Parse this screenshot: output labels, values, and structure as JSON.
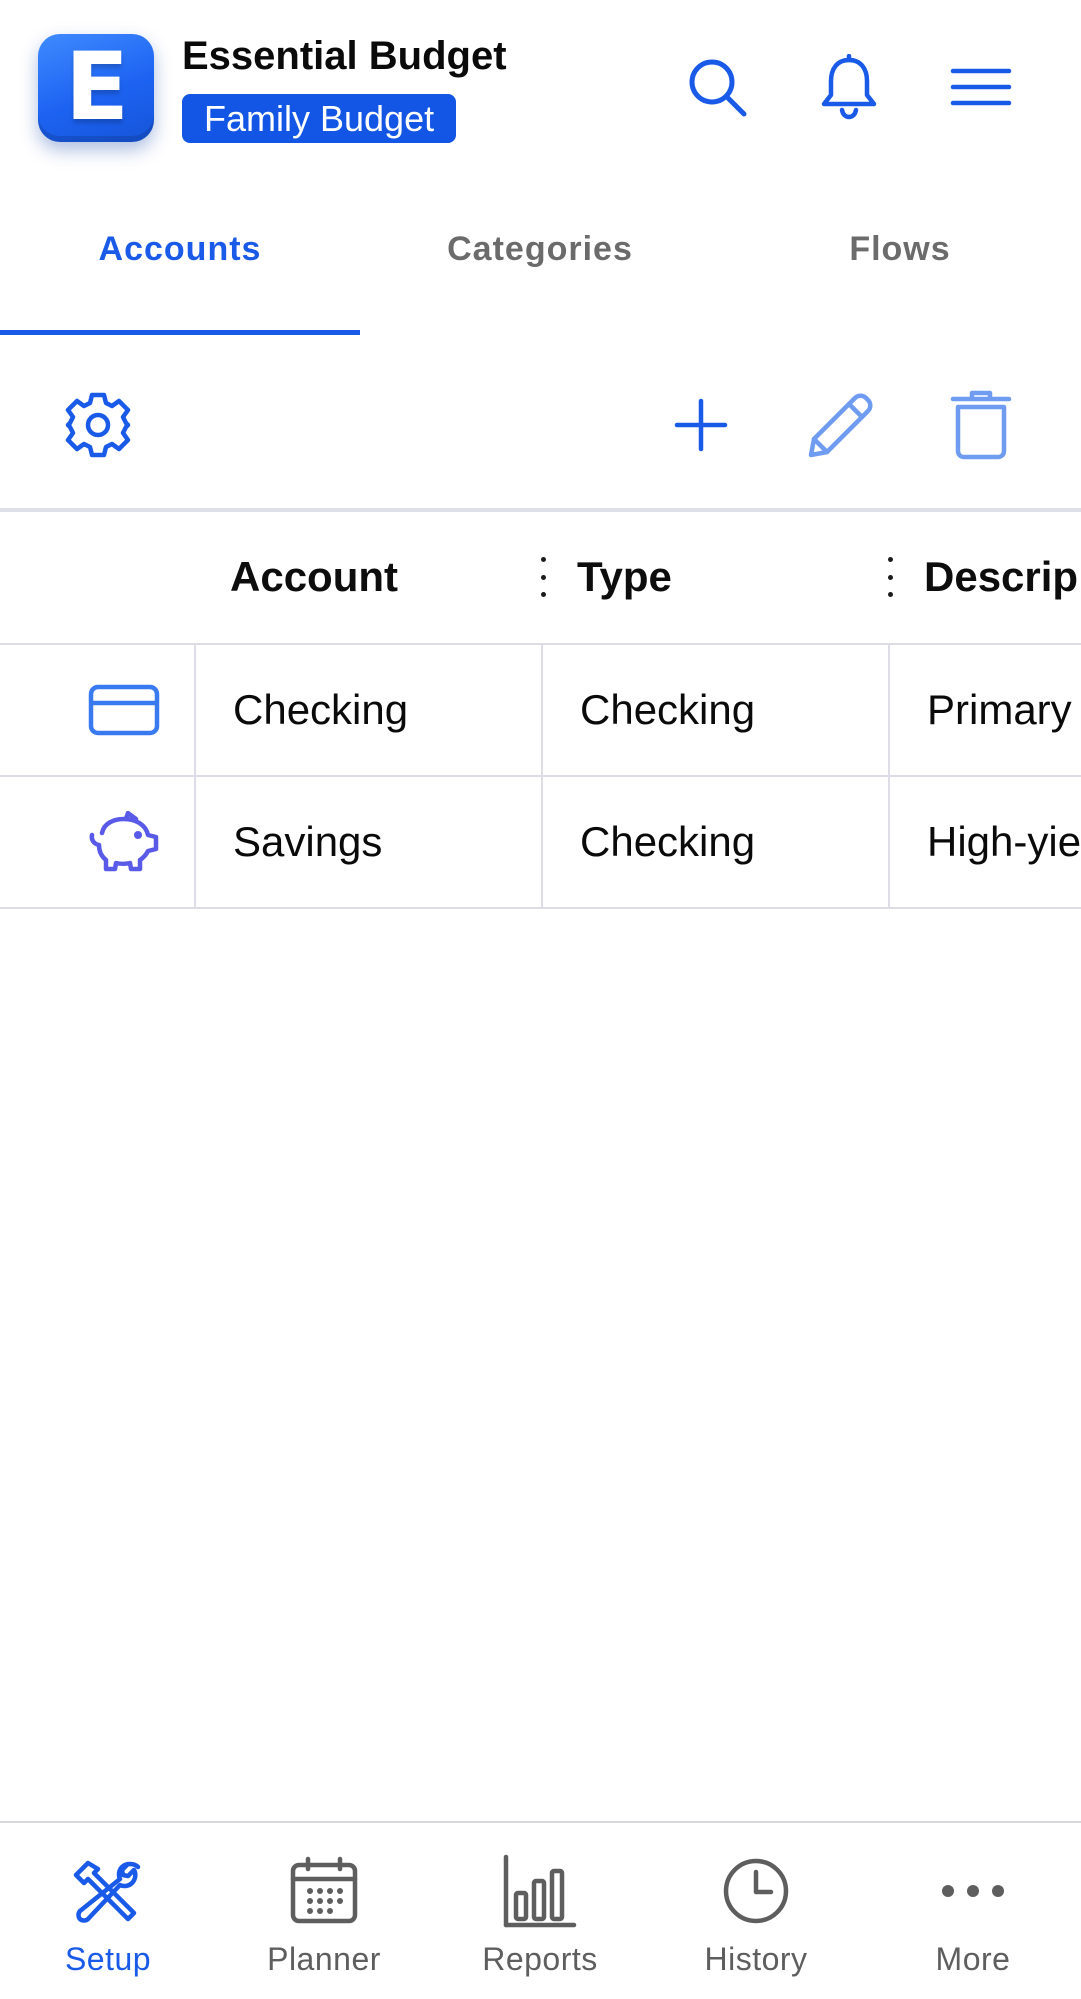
{
  "header": {
    "logo_letter": "E",
    "app_title": "Essential Budget",
    "budget_name": "Family Budget",
    "icons": [
      "search-icon",
      "bell-icon",
      "menu-icon"
    ]
  },
  "tabs": [
    {
      "label": "Accounts",
      "active": true
    },
    {
      "label": "Categories",
      "active": false
    },
    {
      "label": "Flows",
      "active": false
    }
  ],
  "toolbar": {
    "icons": [
      "gear-icon",
      "plus-icon",
      "pencil-icon",
      "trash-icon"
    ]
  },
  "table": {
    "columns": [
      "Account",
      "Type",
      "Descrip"
    ],
    "rows": [
      {
        "icon": "credit-card-icon",
        "account": "Checking",
        "type": "Checking",
        "description": "Primary"
      },
      {
        "icon": "piggy-bank-icon",
        "account": "Savings",
        "type": "Checking",
        "description": "High-yie"
      }
    ]
  },
  "bottom_nav": [
    {
      "label": "Setup",
      "icon": "tools-icon",
      "active": true
    },
    {
      "label": "Planner",
      "icon": "calendar-icon",
      "active": false
    },
    {
      "label": "Reports",
      "icon": "bar-chart-icon",
      "active": false
    },
    {
      "label": "History",
      "icon": "clock-icon",
      "active": false
    },
    {
      "label": "More",
      "icon": "more-dots-icon",
      "active": false
    }
  ],
  "colors": {
    "accent": "#1a5ae8",
    "badge": "#1356e6",
    "accent_light": "#6f9cf0",
    "piggy": "#5a5ae8",
    "muted": "#5e5e5e",
    "divider": "#dcdde6"
  }
}
